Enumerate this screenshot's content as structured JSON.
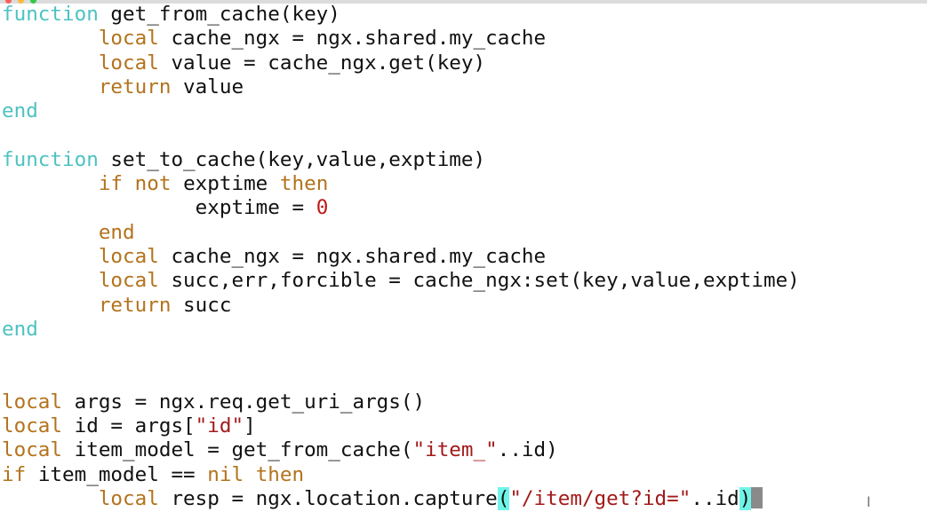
{
  "window": {
    "controls": [
      "close",
      "minimize",
      "zoom"
    ],
    "control_colors": [
      "#fc605c",
      "#fdbc40",
      "#34c84a"
    ]
  },
  "colors": {
    "keyword": "#4ec2c2",
    "lua_keyword": "#b3731d",
    "string": "#a31a1a",
    "number": "#c01818",
    "paren_match": "#6ff5e8",
    "cursor": "#8a8a8a"
  },
  "editor": {
    "lines": [
      [
        [
          "function",
          "kw"
        ],
        [
          " get_from_cache(key)",
          ""
        ]
      ],
      [
        [
          "\t",
          ""
        ],
        [
          "local",
          "lk"
        ],
        [
          " cache_ngx = ngx.shared.my_cache",
          ""
        ]
      ],
      [
        [
          "\t",
          ""
        ],
        [
          "local",
          "lk"
        ],
        [
          " value = cache_ngx.get(key)",
          ""
        ]
      ],
      [
        [
          "\t",
          ""
        ],
        [
          "return",
          "lk"
        ],
        [
          " value",
          ""
        ]
      ],
      [
        [
          "end",
          "kw"
        ]
      ],
      [],
      [
        [
          "function",
          "kw"
        ],
        [
          " set_to_cache(key,value,exptime)",
          ""
        ]
      ],
      [
        [
          "\t",
          ""
        ],
        [
          "if",
          "lk"
        ],
        [
          " ",
          ""
        ],
        [
          "not",
          "lk"
        ],
        [
          " exptime ",
          ""
        ],
        [
          "then",
          "lk"
        ]
      ],
      [
        [
          "\t\t",
          ""
        ],
        [
          "exptime = ",
          ""
        ],
        [
          "0",
          "num"
        ]
      ],
      [
        [
          "\t",
          ""
        ],
        [
          "end",
          "lk"
        ]
      ],
      [
        [
          "\t",
          ""
        ],
        [
          "local",
          "lk"
        ],
        [
          " cache_ngx = ngx.shared.my_cache",
          ""
        ]
      ],
      [
        [
          "\t",
          ""
        ],
        [
          "local",
          "lk"
        ],
        [
          " succ,err,forcible = cache_ngx:set(key,value,exptime)",
          ""
        ]
      ],
      [
        [
          "\t",
          ""
        ],
        [
          "return",
          "lk"
        ],
        [
          " succ",
          ""
        ]
      ],
      [
        [
          "end",
          "kw"
        ]
      ],
      [],
      [],
      [
        [
          "local",
          "lk"
        ],
        [
          " args = ngx.req.get_uri_args()",
          ""
        ]
      ],
      [
        [
          "local",
          "lk"
        ],
        [
          " id = args[",
          ""
        ],
        [
          "\"id\"",
          "str"
        ],
        [
          "]",
          ""
        ]
      ],
      [
        [
          "local",
          "lk"
        ],
        [
          " item_model = get_from_cache(",
          ""
        ],
        [
          "\"item_\"",
          "str"
        ],
        [
          "..id)",
          ""
        ]
      ],
      [
        [
          "if",
          "lk"
        ],
        [
          " item_model == ",
          ""
        ],
        [
          "nil",
          "lk"
        ],
        [
          " ",
          ""
        ],
        [
          "then",
          "lk"
        ]
      ],
      [
        [
          "\t",
          ""
        ],
        [
          "local",
          "lk"
        ],
        [
          " resp = ngx.location.capture",
          ""
        ],
        [
          "(",
          "match"
        ],
        [
          "\"/item/get?id=\"",
          "str"
        ],
        [
          "..id",
          ""
        ],
        [
          ")",
          "match"
        ],
        [
          "",
          "cursor"
        ]
      ]
    ]
  }
}
